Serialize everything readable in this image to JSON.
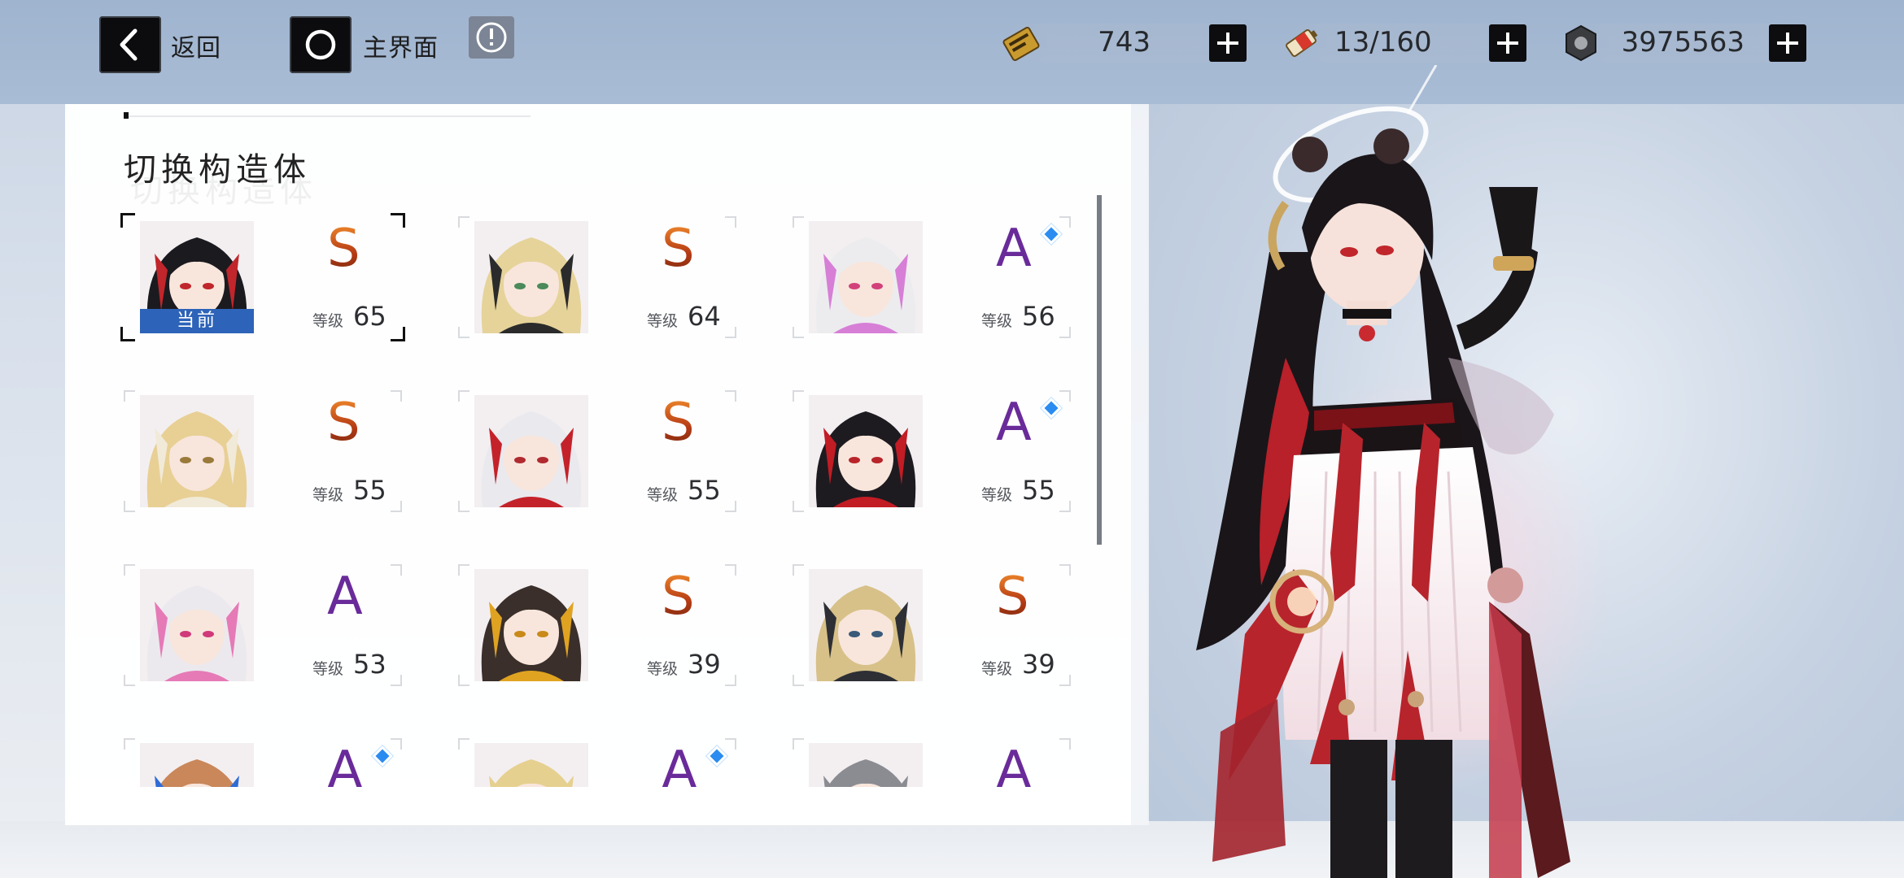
{
  "nav": {
    "back_label": "返回",
    "home_label": "主界面"
  },
  "resources": [
    {
      "icon": "stamina-card-icon",
      "value": "743"
    },
    {
      "icon": "battery-icon",
      "value": "13/160"
    },
    {
      "icon": "coin-icon",
      "value": "3975563"
    }
  ],
  "panel": {
    "title": "切换构造体",
    "current_tag": "当前",
    "level_label": "等级",
    "characters": [
      {
        "rank": "S",
        "level": "65",
        "selected": true,
        "hair": "#1b1a1f",
        "accent": "#c0262b",
        "eye": "#c0262b"
      },
      {
        "rank": "S",
        "level": "64",
        "hair": "#e6d39a",
        "accent": "#2b2b2b",
        "eye": "#4b8a5a"
      },
      {
        "rank": "A",
        "level": "56",
        "diamond": true,
        "hair": "#ececef",
        "accent": "#d77fd6",
        "eye": "#d2427a"
      },
      {
        "rank": "S",
        "level": "55",
        "hair": "#e8cf94",
        "accent": "#f1ead8",
        "eye": "#9a7a3a"
      },
      {
        "rank": "S",
        "level": "55",
        "hair": "#e9e9ee",
        "accent": "#c4222a",
        "eye": "#b02a30"
      },
      {
        "rank": "A",
        "level": "55",
        "diamond": true,
        "hair": "#1d1b20",
        "accent": "#c21c24",
        "eye": "#b8242a"
      },
      {
        "rank": "A",
        "level": "53",
        "hair": "#ece9ee",
        "accent": "#e57ab7",
        "eye": "#d03a7a"
      },
      {
        "rank": "S",
        "level": "39",
        "hair": "#3a2f2a",
        "accent": "#e0a321",
        "eye": "#c98a1a"
      },
      {
        "rank": "S",
        "level": "39",
        "hair": "#d7c188",
        "accent": "#2d2f35",
        "eye": "#3a5a7a"
      },
      {
        "rank": "A",
        "level": "",
        "diamond": true,
        "partial": true,
        "hair": "#c9875a",
        "accent": "#2e6bd6",
        "eye": "#444"
      },
      {
        "rank": "A",
        "level": "",
        "diamond": true,
        "partial": true,
        "hair": "#e6d08f",
        "accent": "#e6d08f",
        "eye": "#444"
      },
      {
        "rank": "A",
        "level": "",
        "partial": true,
        "hair": "#8b8c92",
        "accent": "#8b8c92",
        "eye": "#444"
      }
    ]
  },
  "colors": {
    "selected_tag": "#2d63b8",
    "rank_s": "#d95a1a",
    "rank_a": "#6a2b9a",
    "diamond": "#2a8cf0"
  }
}
